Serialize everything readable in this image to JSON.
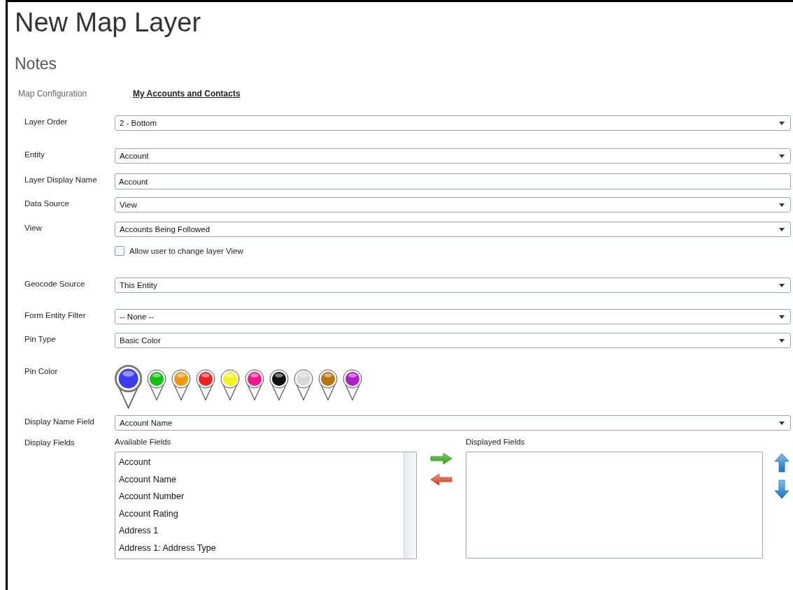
{
  "title": "New Map Layer",
  "section": "Notes",
  "config": {
    "label": "Map Configuration",
    "link": "My Accounts and Contacts"
  },
  "rows": [
    {
      "kind": "dropdown",
      "label": "Layer Order",
      "value": "2 - Bottom"
    },
    {
      "kind": "dropdown",
      "label": "Entity",
      "value": "Account"
    },
    {
      "kind": "text",
      "label": "Layer Display Name",
      "value": "Account"
    },
    {
      "kind": "dropdown",
      "label": "Data Source",
      "value": "View"
    },
    {
      "kind": "dropdown",
      "label": "View",
      "value": "Accounts Being Followed"
    },
    {
      "kind": "checkbox",
      "text": "Allow user to change layer View",
      "checked": false
    },
    {
      "kind": "dropdown",
      "label": "Geocode Source",
      "value": "This Entity"
    },
    {
      "kind": "dropdown",
      "label": "Form Entity Filter",
      "value": "-- None --"
    },
    {
      "kind": "dropdown",
      "label": "Pin Type",
      "value": "Basic Color"
    },
    {
      "kind": "pins",
      "label": "Pin Color",
      "pins": [
        {
          "color": "#3c3cf0",
          "selected": true
        },
        {
          "color": "#12c212",
          "selected": false
        },
        {
          "color": "#f0960f",
          "selected": false
        },
        {
          "color": "#ee2020",
          "selected": false
        },
        {
          "color": "#f2f21c",
          "selected": false
        },
        {
          "color": "#f0158a",
          "selected": false
        },
        {
          "color": "#111111",
          "selected": false
        },
        {
          "color": "#d8d8d8",
          "selected": false
        },
        {
          "color": "#b8740e",
          "selected": false
        },
        {
          "color": "#b01ec8",
          "selected": false
        }
      ]
    },
    {
      "kind": "dropdown",
      "label": "Display Name Field",
      "value": "Account Name"
    }
  ],
  "display_fields": {
    "label": "Display Fields",
    "available_label": "Available Fields",
    "available": [
      "Account",
      "Account Name",
      "Account Number",
      "Account Rating",
      "Address 1",
      "Address 1: Address Type"
    ],
    "displayed_label": "Displayed Fields"
  }
}
